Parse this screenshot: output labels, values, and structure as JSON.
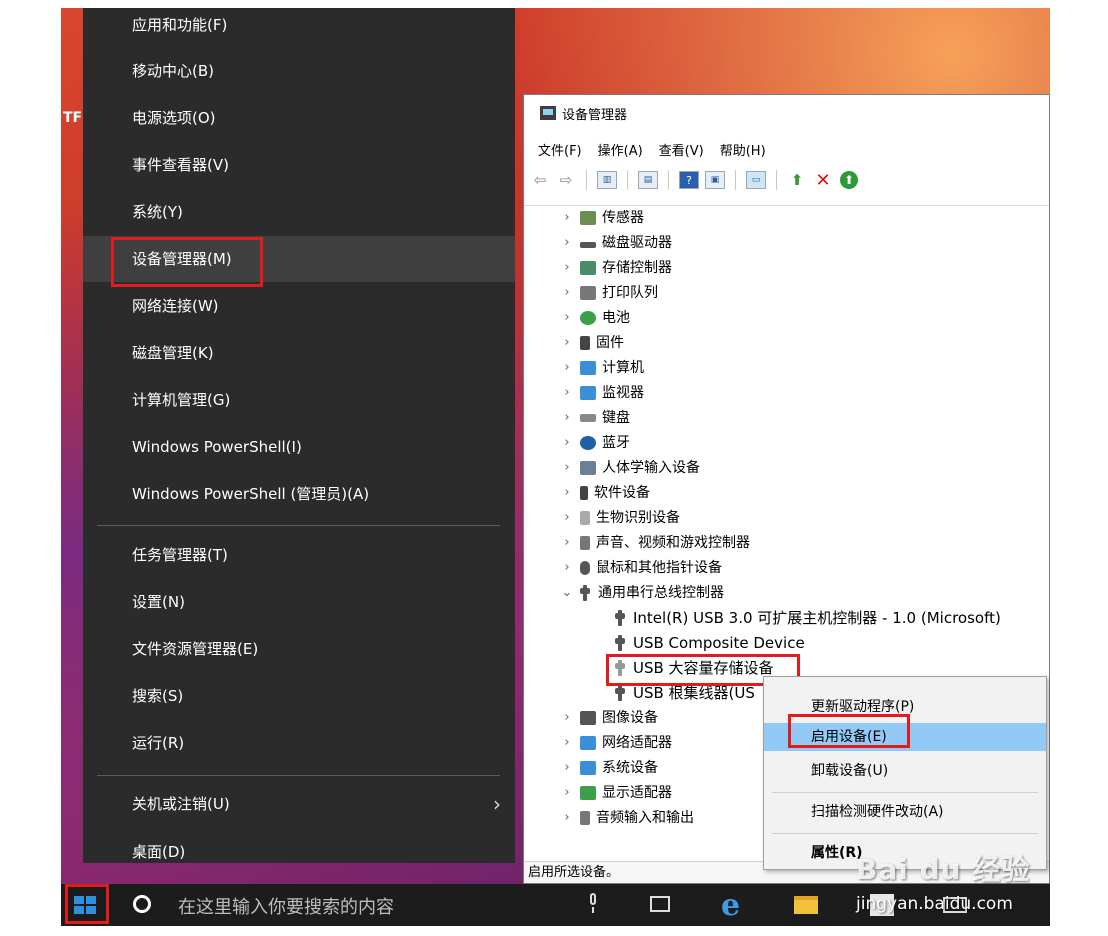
{
  "desktop": {
    "edge_text": "TF"
  },
  "winx_menu": {
    "items": [
      "应用和功能(F)",
      "移动中心(B)",
      "电源选项(O)",
      "事件查看器(V)",
      "系统(Y)",
      "设备管理器(M)",
      "网络连接(W)",
      "磁盘管理(K)",
      "计算机管理(G)",
      "Windows PowerShell(I)",
      "Windows PowerShell (管理员)(A)",
      "任务管理器(T)",
      "设置(N)",
      "文件资源管理器(E)",
      "搜索(S)",
      "运行(R)",
      "关机或注销(U)",
      "桌面(D)"
    ],
    "submenu_arrow": "›"
  },
  "device_manager": {
    "title": "设备管理器",
    "menu": [
      "文件(F)",
      "操作(A)",
      "查看(V)",
      "帮助(H)"
    ],
    "tree": [
      {
        "label": "传感器",
        "expanded": false,
        "icon_color": "#6b8e4e"
      },
      {
        "label": "磁盘驱动器",
        "expanded": false,
        "icon_color": "#555555"
      },
      {
        "label": "存储控制器",
        "expanded": false,
        "icon_color": "#4c8a6a"
      },
      {
        "label": "打印队列",
        "expanded": false,
        "icon_color": "#777777"
      },
      {
        "label": "电池",
        "expanded": false,
        "icon_color": "#3aa14a"
      },
      {
        "label": "固件",
        "expanded": false,
        "icon_color": "#444444"
      },
      {
        "label": "计算机",
        "expanded": false,
        "icon_color": "#3a8fd8"
      },
      {
        "label": "监视器",
        "expanded": false,
        "icon_color": "#3a8fd8"
      },
      {
        "label": "键盘",
        "expanded": false,
        "icon_color": "#666666"
      },
      {
        "label": "蓝牙",
        "expanded": false,
        "icon_color": "#1f5fa8"
      },
      {
        "label": "人体学输入设备",
        "expanded": false,
        "icon_color": "#6b7f99"
      },
      {
        "label": "软件设备",
        "expanded": false,
        "icon_color": "#444444"
      },
      {
        "label": "生物识别设备",
        "expanded": false,
        "icon_color": "#999999"
      },
      {
        "label": "声音、视频和游戏控制器",
        "expanded": false,
        "icon_color": "#777777"
      },
      {
        "label": "鼠标和其他指针设备",
        "expanded": false,
        "icon_color": "#555555"
      },
      {
        "label": "通用串行总线控制器",
        "expanded": true,
        "icon_color": "#555555"
      }
    ],
    "usb_children": [
      "Intel(R) USB 3.0 可扩展主机控制器 - 1.0 (Microsoft)",
      "USB Composite Device",
      "USB 大容量存储设备",
      "USB 根集线器(US"
    ],
    "tree_after": [
      {
        "label": "图像设备",
        "icon_color": "#555555"
      },
      {
        "label": "网络适配器",
        "icon_color": "#3a8fd8"
      },
      {
        "label": "系统设备",
        "icon_color": "#3a8fd8"
      },
      {
        "label": "显示适配器",
        "icon_color": "#3aa14a"
      },
      {
        "label": "音频输入和输出",
        "icon_color": "#777777"
      }
    ],
    "status": "启用所选设备。",
    "expand_glyph": "›",
    "collapse_glyph": "⌄"
  },
  "context_menu": {
    "items": [
      "更新驱动程序(P)",
      "启用设备(E)",
      "卸载设备(U)",
      "扫描检测硬件改动(A)",
      "属性(R)"
    ]
  },
  "taskbar": {
    "search_placeholder": "在这里输入你要搜索的内容",
    "edge_glyph": "e"
  },
  "watermark": {
    "logo": "Bai du 经验",
    "url": "jingyan.baidu.com"
  },
  "colors": {
    "highlight_red": "#e21b1b",
    "menu_bg": "#2b2b2b",
    "context_highlight": "#91c9f7"
  }
}
